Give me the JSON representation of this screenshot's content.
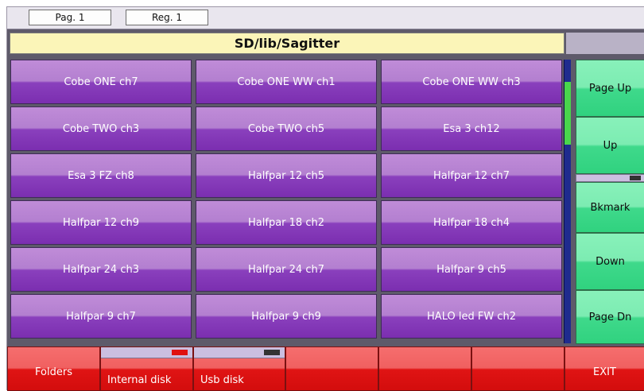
{
  "topbar": {
    "page_label": "Pag. 1",
    "reg_label": "Reg. 1"
  },
  "path": "SD/lib/Sagitter",
  "fixtures": [
    "Cobe ONE ch7",
    "Cobe ONE WW ch1",
    "Cobe ONE WW ch3",
    "Cobe TWO ch3",
    "Cobe TWO ch5",
    "Esa 3 ch12",
    "Esa 3 FZ ch8",
    "Halfpar 12 ch5",
    "Halfpar 12 ch7",
    "Halfpar 12 ch9",
    "Halfpar 18 ch2",
    "Halfpar 18 ch4",
    "Halfpar 24 ch3",
    "Halfpar 24 ch7",
    "Halfpar 9 ch5",
    "Halfpar 9 ch7",
    "Halfpar 9 ch9",
    "HALO led FW ch2"
  ],
  "side_buttons": {
    "page_up": "Page Up",
    "up": "Up",
    "bkmark": "Bkmark",
    "down": "Down",
    "page_dn": "Page Dn"
  },
  "scrollbar": {
    "position": 0.1,
    "visible_fraction": 0.22
  },
  "bottom": {
    "folders": "Folders",
    "internal_disk": "Internal disk",
    "usb_disk": "Usb disk",
    "exit": "EXIT"
  },
  "colors": {
    "fixture_button": "#8a40bd",
    "side_button": "#30d27f",
    "bottom_button": "#d30d0d",
    "path_bar": "#fbf5b8",
    "internal_disk_indicator": "#e01010",
    "usb_disk_indicator": "#333333",
    "scroll_thumb": "#49d64c"
  }
}
